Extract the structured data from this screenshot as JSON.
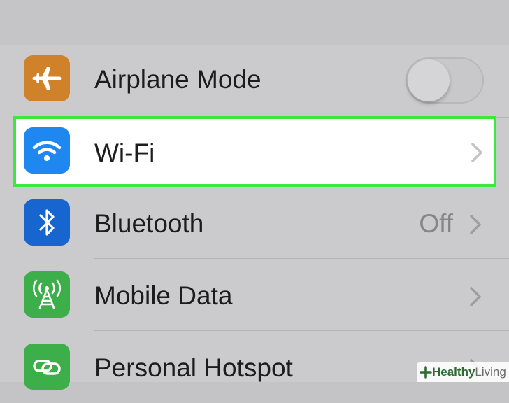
{
  "settings": {
    "airplane_mode": {
      "label": "Airplane Mode",
      "icon": "airplane-icon",
      "icon_color": "#d0822a",
      "toggle_on": false
    },
    "wifi": {
      "label": "Wi-Fi",
      "icon": "wifi-icon",
      "icon_color": "#1e87f0",
      "highlight_color": "#3de83d"
    },
    "bluetooth": {
      "label": "Bluetooth",
      "value": "Off",
      "icon": "bluetooth-icon",
      "icon_color": "#1766cf"
    },
    "mobile_data": {
      "label": "Mobile Data",
      "icon": "cellular-antenna-icon",
      "icon_color": "#3cae4a"
    },
    "personal_hotspot": {
      "label": "Personal Hotspot",
      "icon": "hotspot-link-icon",
      "icon_color": "#3cae4a"
    }
  },
  "watermark": {
    "bold": "Healthy",
    "light": "Living"
  }
}
